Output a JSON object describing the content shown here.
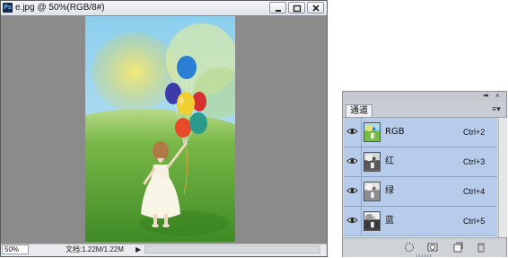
{
  "document": {
    "app_icon_text": "Ps",
    "title": "e.jpg @ 50%(RGB/8#)",
    "zoom": "50%",
    "status": "文档:1.22M/1.22M",
    "status_arrow": "▶"
  },
  "channels_panel": {
    "tab_label": "通道",
    "collapse_glyph": "◂◂",
    "close_glyph": "×",
    "menu_glyph": "≡▾",
    "channels": [
      {
        "name": "RGB",
        "shortcut": "Ctrl+2",
        "thumb": "color"
      },
      {
        "name": "红",
        "shortcut": "Ctrl+3",
        "thumb": "gray"
      },
      {
        "name": "绿",
        "shortcut": "Ctrl+4",
        "thumb": "gray"
      },
      {
        "name": "蓝",
        "shortcut": "Ctrl+5",
        "thumb": "gray"
      }
    ],
    "bottom_icons": [
      "load-selection-icon",
      "save-selection-icon",
      "new-channel-icon",
      "delete-channel-icon"
    ]
  },
  "colors": {
    "row_highlight": "#b7cbea",
    "canvas_gray": "#8b8b8b",
    "sky": "#9fd6ee",
    "grass": "#4e9a2d"
  }
}
